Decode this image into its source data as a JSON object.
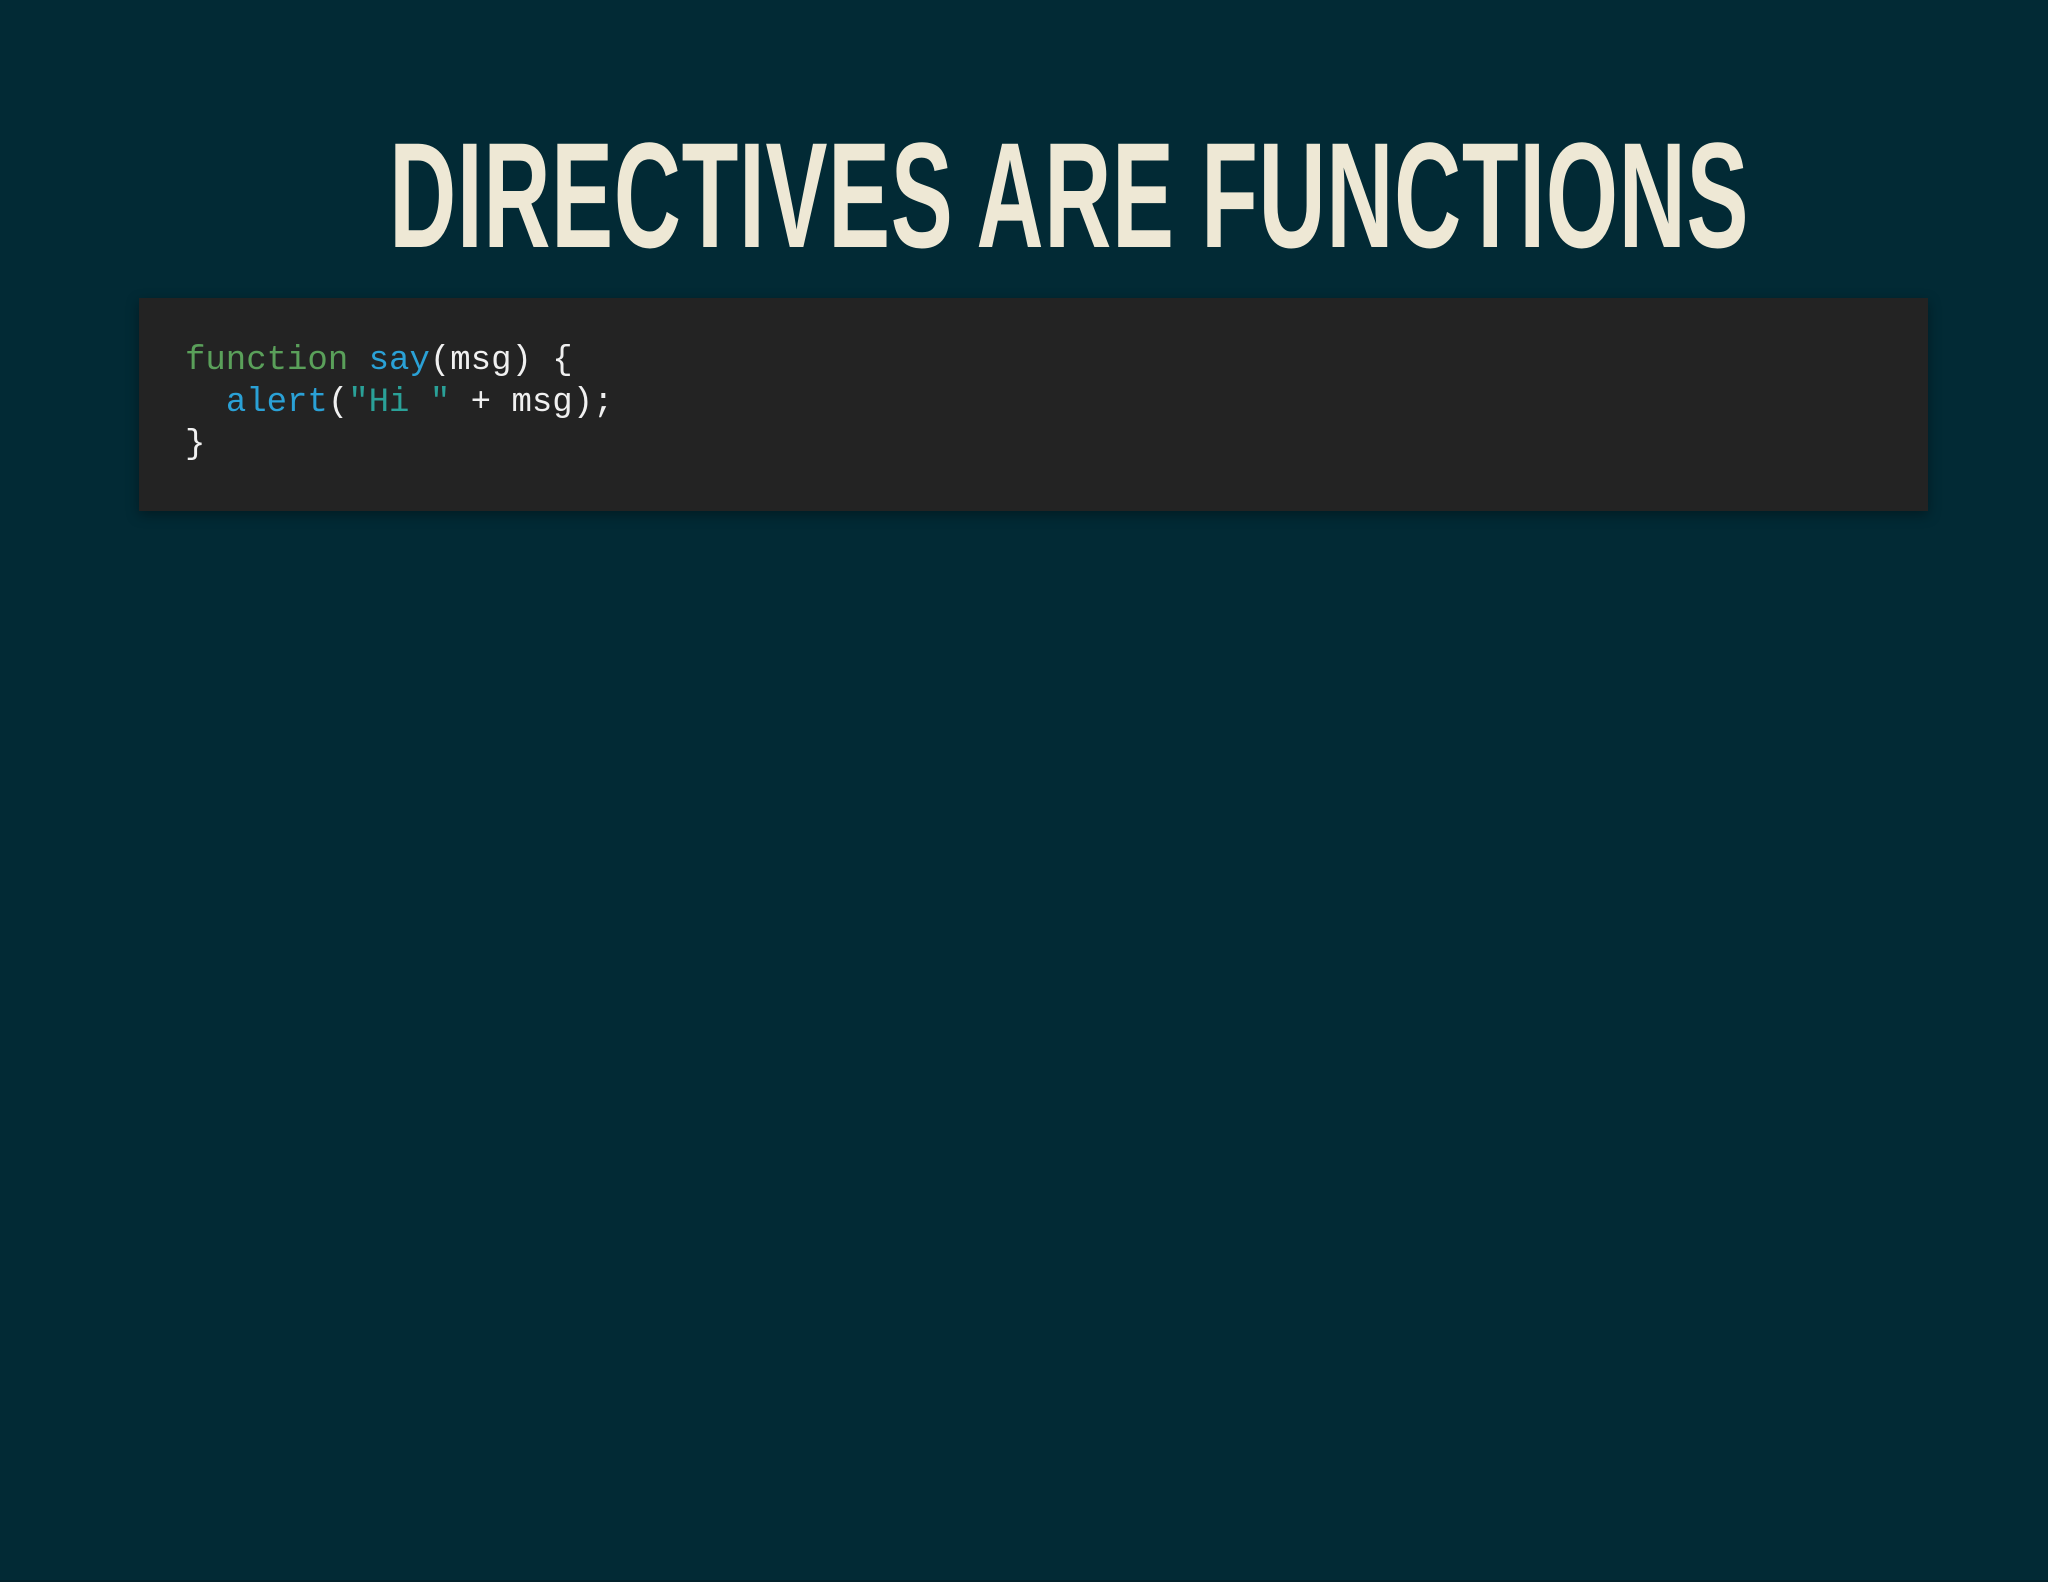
{
  "slide": {
    "title": "DIRECTIVES ARE FUNCTIONS",
    "code": {
      "line1": {
        "keyword": "function",
        "space1": " ",
        "func_name": "say",
        "rest": "(msg) {"
      },
      "line2": {
        "indent": "  ",
        "func_call": "alert",
        "open_paren": "(",
        "string": "\"Hi \"",
        "rest": " + msg);"
      },
      "line3": {
        "text": "}"
      }
    }
  },
  "colors": {
    "background": "#022a35",
    "title": "#eee8d5",
    "code_background": "#232323",
    "keyword": "#5aa05a",
    "function_name": "#2aa1d6",
    "string": "#2aa198",
    "plain_text": "#f0f0f0"
  }
}
